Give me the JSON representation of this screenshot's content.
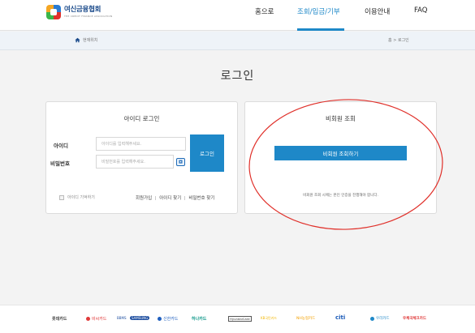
{
  "header": {
    "logo_title": "여신금융협회",
    "logo_sub": "THE CREDIT FINANCE ASSOCIATION",
    "nav": [
      {
        "label": "홈으로",
        "active": false
      },
      {
        "label": "조회/입금/기부",
        "active": true
      },
      {
        "label": "이용안내",
        "active": false
      },
      {
        "label": "FAQ",
        "active": false
      }
    ],
    "accent": "#1e88c8"
  },
  "breadcrumb": {
    "home_icon": "home-icon",
    "label": "현재위치",
    "path": "홈 > 로그인"
  },
  "page_title": "로그인",
  "login_panel": {
    "title": "아이디 로그인",
    "id_label": "아이디",
    "id_placeholder": "아이디를 입력해주세요.",
    "pw_label": "비밀번호",
    "pw_placeholder": "비밀번호를 입력해주세요.",
    "keyboard_icon": "virtual-keyboard-icon",
    "login_button": "로그인",
    "remember_label": "아이디 기억하기",
    "links": [
      "회원가입",
      "아이디 찾기",
      "비밀번호 찾기"
    ]
  },
  "guest_panel": {
    "title": "비회원 조회",
    "button": "비회원 조회하기",
    "notice": "비회원 조회 시에는 본인 인증을 진행해야 합니다."
  },
  "annotation_color": "#e0302a",
  "footer": {
    "partners": [
      {
        "name": "롯데카드",
        "color": "#444444"
      },
      {
        "name": "비씨카드",
        "color": "#e03a3a"
      },
      {
        "name": "BBMS",
        "color": "#1f4fa0"
      },
      {
        "name": "SAMSUNG",
        "color": "#1f4fa0"
      },
      {
        "name": "신한카드",
        "color": "#1f5fbf"
      },
      {
        "name": "하나카드",
        "color": "#159a8c"
      },
      {
        "name": "HyundaiCard",
        "color": "#333333"
      },
      {
        "name": "KB국민카드",
        "color": "#f2b705"
      },
      {
        "name": "NH농협카드",
        "color": "#f2a000"
      },
      {
        "name": "citi",
        "color": "#1a5ab8"
      },
      {
        "name": "우리카드",
        "color": "#1e88c8"
      },
      {
        "name": "우체국체크카드",
        "color": "#e03a3a"
      }
    ]
  }
}
